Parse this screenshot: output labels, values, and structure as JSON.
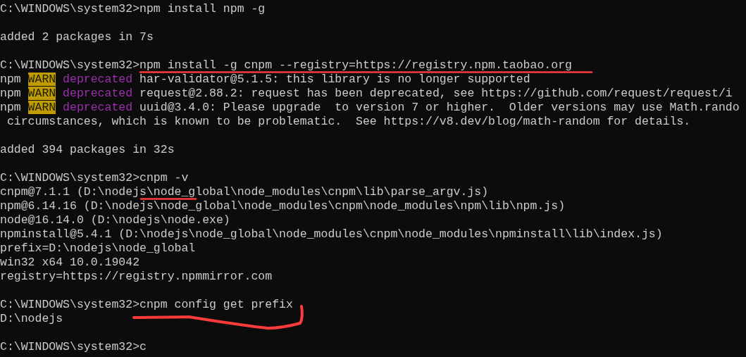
{
  "console": {
    "lines": [
      {
        "kind": "text",
        "segments": [
          {
            "kind": "plain",
            "text": "C:\\WINDOWS\\system32>npm install npm -g"
          }
        ]
      },
      {
        "kind": "blank"
      },
      {
        "kind": "text",
        "segments": [
          {
            "kind": "plain",
            "text": "added 2 packages in 7s"
          }
        ]
      },
      {
        "kind": "blank"
      },
      {
        "kind": "text",
        "segments": [
          {
            "kind": "plain",
            "text": "C:\\WINDOWS\\system32>npm install -g cnpm --registry=https://registry.npm.taobao.org"
          }
        ]
      },
      {
        "kind": "text",
        "segments": [
          {
            "kind": "plain",
            "text": "npm "
          },
          {
            "kind": "warn",
            "text": "WARN"
          },
          {
            "kind": "deprecated",
            "text": "deprecated"
          },
          {
            "kind": "plain",
            "text": " har-validator@5.1.5: this library is no longer supported"
          }
        ]
      },
      {
        "kind": "text",
        "segments": [
          {
            "kind": "plain",
            "text": "npm "
          },
          {
            "kind": "warn",
            "text": "WARN"
          },
          {
            "kind": "deprecated",
            "text": "deprecated"
          },
          {
            "kind": "plain",
            "text": " request@2.88.2: request has been deprecated, see https://github.com/request/request/i"
          }
        ]
      },
      {
        "kind": "text",
        "segments": [
          {
            "kind": "plain",
            "text": "npm "
          },
          {
            "kind": "warn",
            "text": "WARN"
          },
          {
            "kind": "deprecated",
            "text": "deprecated"
          },
          {
            "kind": "plain",
            "text": " uuid@3.4.0: Please upgrade  to version 7 or higher.  Older versions may use Math.rando"
          }
        ]
      },
      {
        "kind": "text",
        "segments": [
          {
            "kind": "plain",
            "text": " circumstances, which is known to be problematic.  See https://v8.dev/blog/math-random for details."
          }
        ]
      },
      {
        "kind": "blank"
      },
      {
        "kind": "text",
        "segments": [
          {
            "kind": "plain",
            "text": "added 394 packages in 32s"
          }
        ]
      },
      {
        "kind": "blank"
      },
      {
        "kind": "text",
        "segments": [
          {
            "kind": "plain",
            "text": "C:\\WINDOWS\\system32>cnpm -v"
          }
        ]
      },
      {
        "kind": "text",
        "segments": [
          {
            "kind": "plain",
            "text": "cnpm@7.1.1 (D:\\nodejs\\node_global\\node_modules\\cnpm\\lib\\parse_argv.js)"
          }
        ]
      },
      {
        "kind": "text",
        "segments": [
          {
            "kind": "plain",
            "text": "npm@6.14.16 (D:\\nodejs\\node_global\\node_modules\\cnpm\\node_modules\\npm\\lib\\npm.js)"
          }
        ]
      },
      {
        "kind": "text",
        "segments": [
          {
            "kind": "plain",
            "text": "node@16.14.0 (D:\\nodejs\\node.exe)"
          }
        ]
      },
      {
        "kind": "text",
        "segments": [
          {
            "kind": "plain",
            "text": "npminstall@5.4.1 (D:\\nodejs\\node_global\\node_modules\\cnpm\\node_modules\\npminstall\\lib\\index.js)"
          }
        ]
      },
      {
        "kind": "text",
        "segments": [
          {
            "kind": "plain",
            "text": "prefix=D:\\nodejs\\node_global"
          }
        ]
      },
      {
        "kind": "text",
        "segments": [
          {
            "kind": "plain",
            "text": "win32 x64 10.0.19042"
          }
        ]
      },
      {
        "kind": "text",
        "segments": [
          {
            "kind": "plain",
            "text": "registry=https://registry.npmmirror.com"
          }
        ]
      },
      {
        "kind": "blank"
      },
      {
        "kind": "text",
        "segments": [
          {
            "kind": "plain",
            "text": "C:\\WINDOWS\\system32>cnpm config get prefix"
          }
        ]
      },
      {
        "kind": "text",
        "segments": [
          {
            "kind": "plain",
            "text": "D:\\nodejs"
          }
        ]
      },
      {
        "kind": "blank"
      },
      {
        "kind": "text",
        "segments": [
          {
            "kind": "plain",
            "text": "C:\\WINDOWS\\system32>c"
          }
        ]
      }
    ]
  }
}
